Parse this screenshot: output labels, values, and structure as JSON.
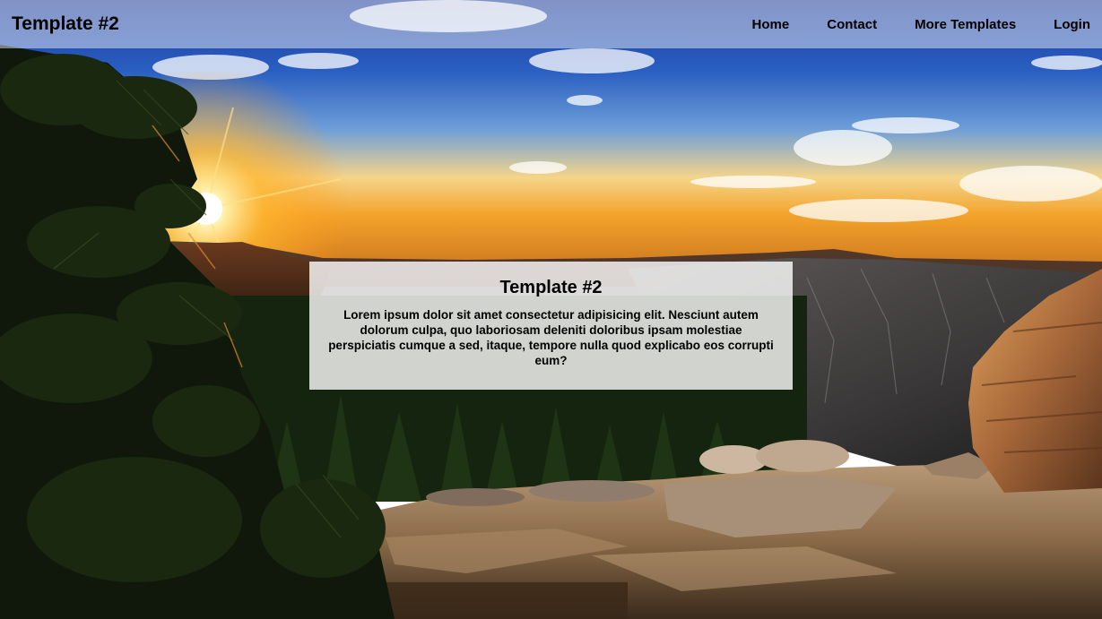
{
  "header": {
    "brand": "Template #2",
    "nav": [
      {
        "label": "Home"
      },
      {
        "label": "Contact"
      },
      {
        "label": "More Templates"
      },
      {
        "label": "Login"
      }
    ]
  },
  "card": {
    "title": "Template #2",
    "body": "Lorem ipsum dolor sit amet consectetur adipisicing elit. Nesciunt autem dolorum culpa, quo laboriosam deleniti doloribus ipsam molestiae perspiciatis cumque a sed, itaque, tempore nulla quod explicabo eos corrupti eum?"
  },
  "colors": {
    "sky_top": "#1d3f9e",
    "sky_mid": "#5a8fd6",
    "horizon": "#f2a52a",
    "rock": "#8a6a48",
    "forest": "#17260f"
  }
}
